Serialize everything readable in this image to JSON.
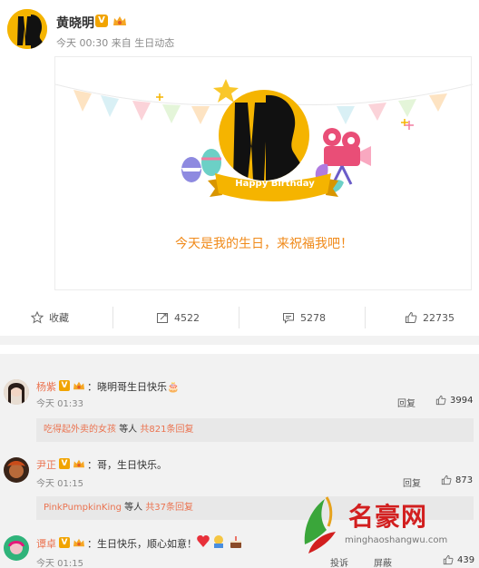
{
  "post": {
    "author": "黄晓明",
    "meta": "今天 00:30 来自 生日动态",
    "card": {
      "banner_label": "Happy Birthday",
      "message": "今天是我的生日，来祝福我吧！"
    }
  },
  "actions": {
    "favorite": "收藏",
    "repost": "4522",
    "comment": "5278",
    "like": "22735"
  },
  "comments": [
    {
      "user": "杨紫",
      "text": "：晓明哥生日快乐🎂",
      "time": "今天 01:33",
      "reply_label": "回复",
      "likes": "3994",
      "sub": {
        "user": "吃得起外卖的女孩",
        "middle": "等人",
        "count": "共821条回复"
      }
    },
    {
      "user": "尹正",
      "text": "：哥，生日快乐。",
      "time": "今天 01:15",
      "reply_label": "回复",
      "likes": "873",
      "sub": {
        "user": "PinkPumpkinKing",
        "middle": "等人",
        "count": "共37条回复"
      }
    },
    {
      "user": "谭卓",
      "text": "：生日快乐，顺心如意！",
      "time": "今天 01:15",
      "report_label": "投诉",
      "block_label": "屏蔽",
      "likes": "439"
    }
  ],
  "watermark": {
    "name": "名豪网",
    "url": "minghaoshangwu.com"
  },
  "colors": {
    "brand_orange": "#f5b400",
    "username": "#eb7350",
    "wish_text": "#f08a1a"
  }
}
